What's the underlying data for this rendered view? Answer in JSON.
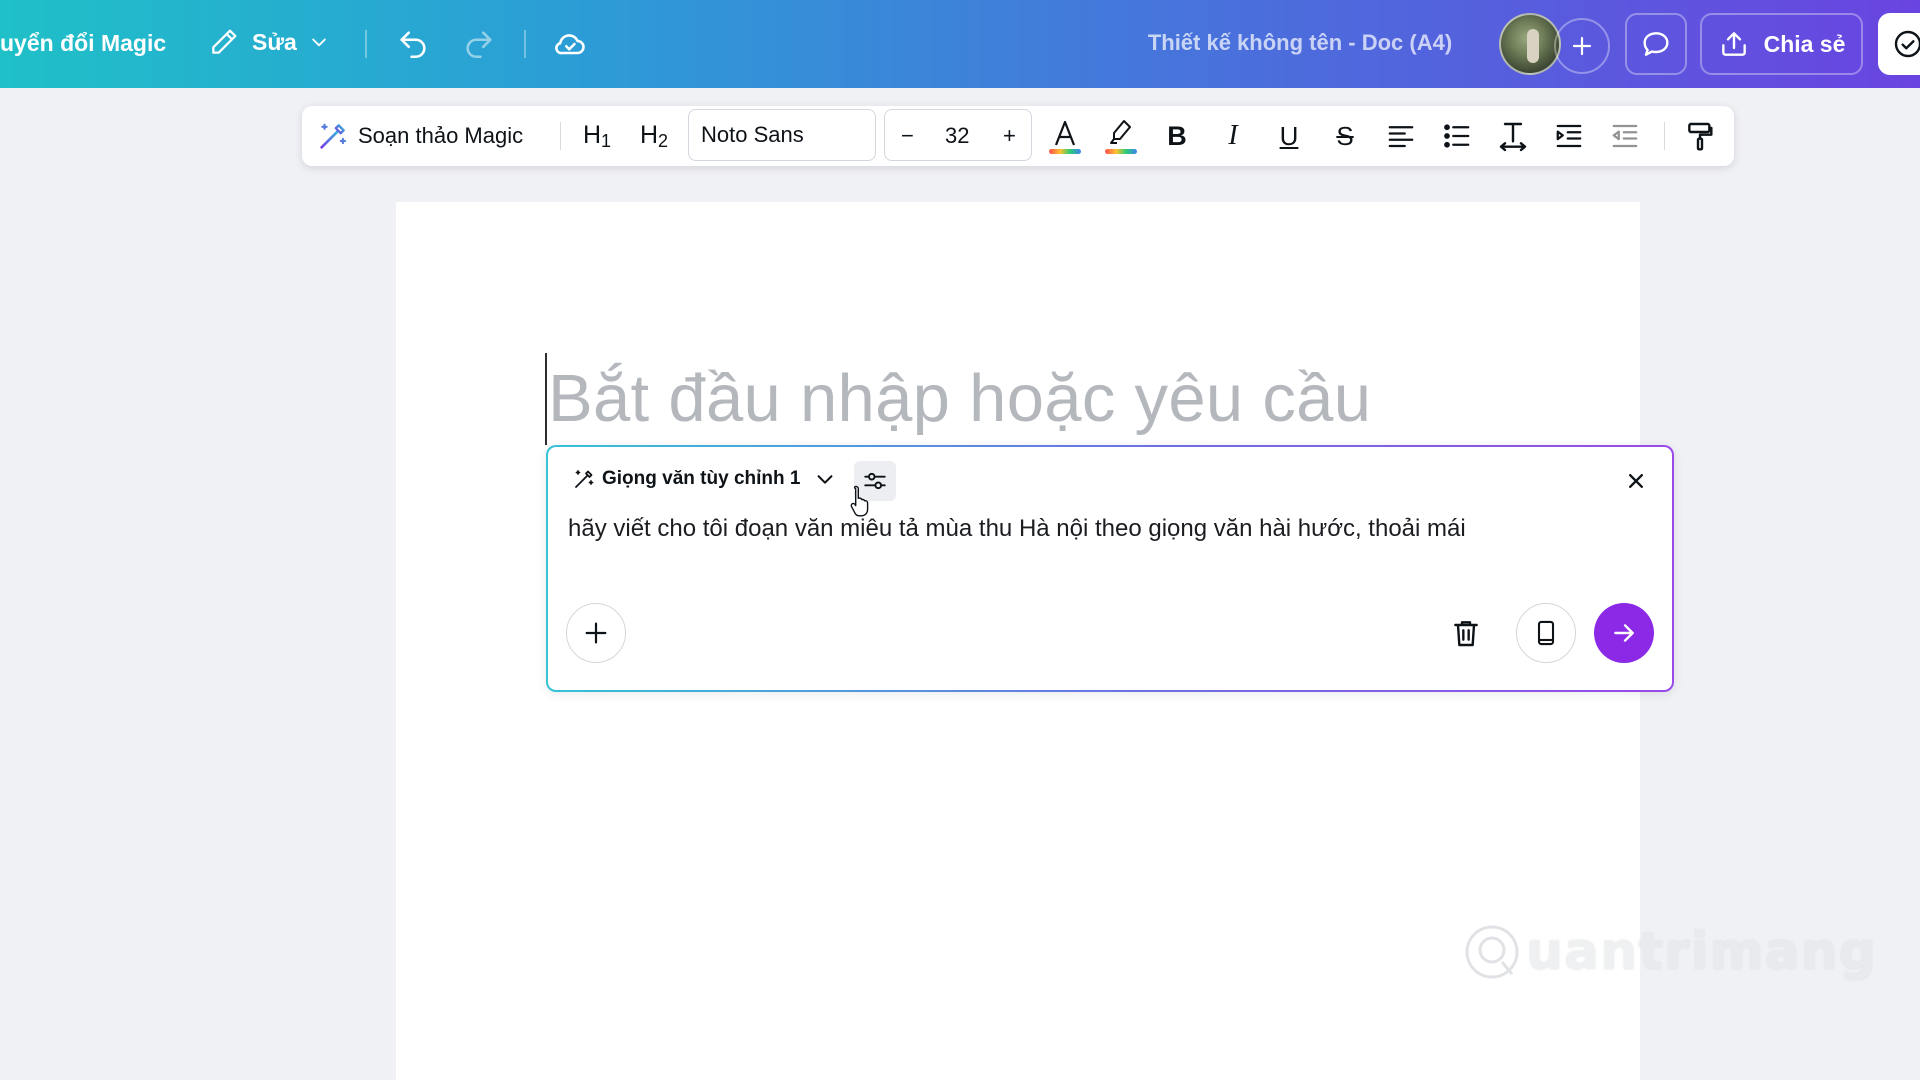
{
  "topbar": {
    "magic_switch_label": "uyển đổi Magic",
    "edit_label": "Sửa",
    "doc_title": "Thiết kế không tên - Doc (A4)",
    "share_label": "Chia sẻ"
  },
  "format_toolbar": {
    "magic_write_label": "Soạn thảo Magic",
    "h1_main": "H",
    "h1_sub": "1",
    "h2_main": "H",
    "h2_sub": "2",
    "font_name": "Noto Sans",
    "font_size": "32",
    "decrease_glyph": "−",
    "increase_glyph": "+",
    "bold_glyph": "B",
    "italic_glyph": "I",
    "underline_glyph": "U",
    "strike_glyph": "S"
  },
  "document": {
    "placeholder": "Bắt đầu nhập hoặc yêu cầu"
  },
  "magic_panel": {
    "voice_label": "Giọng văn tùy chỉnh 1",
    "prompt": "hãy viết cho tôi đoạn văn miêu tả mùa thu Hà nội theo giọng văn hài hước, thoải mái"
  },
  "watermark": {
    "text": "uantrimang"
  },
  "colors": {
    "send_button": "#8b29e6",
    "placeholder_text": "#b4b8bd"
  }
}
